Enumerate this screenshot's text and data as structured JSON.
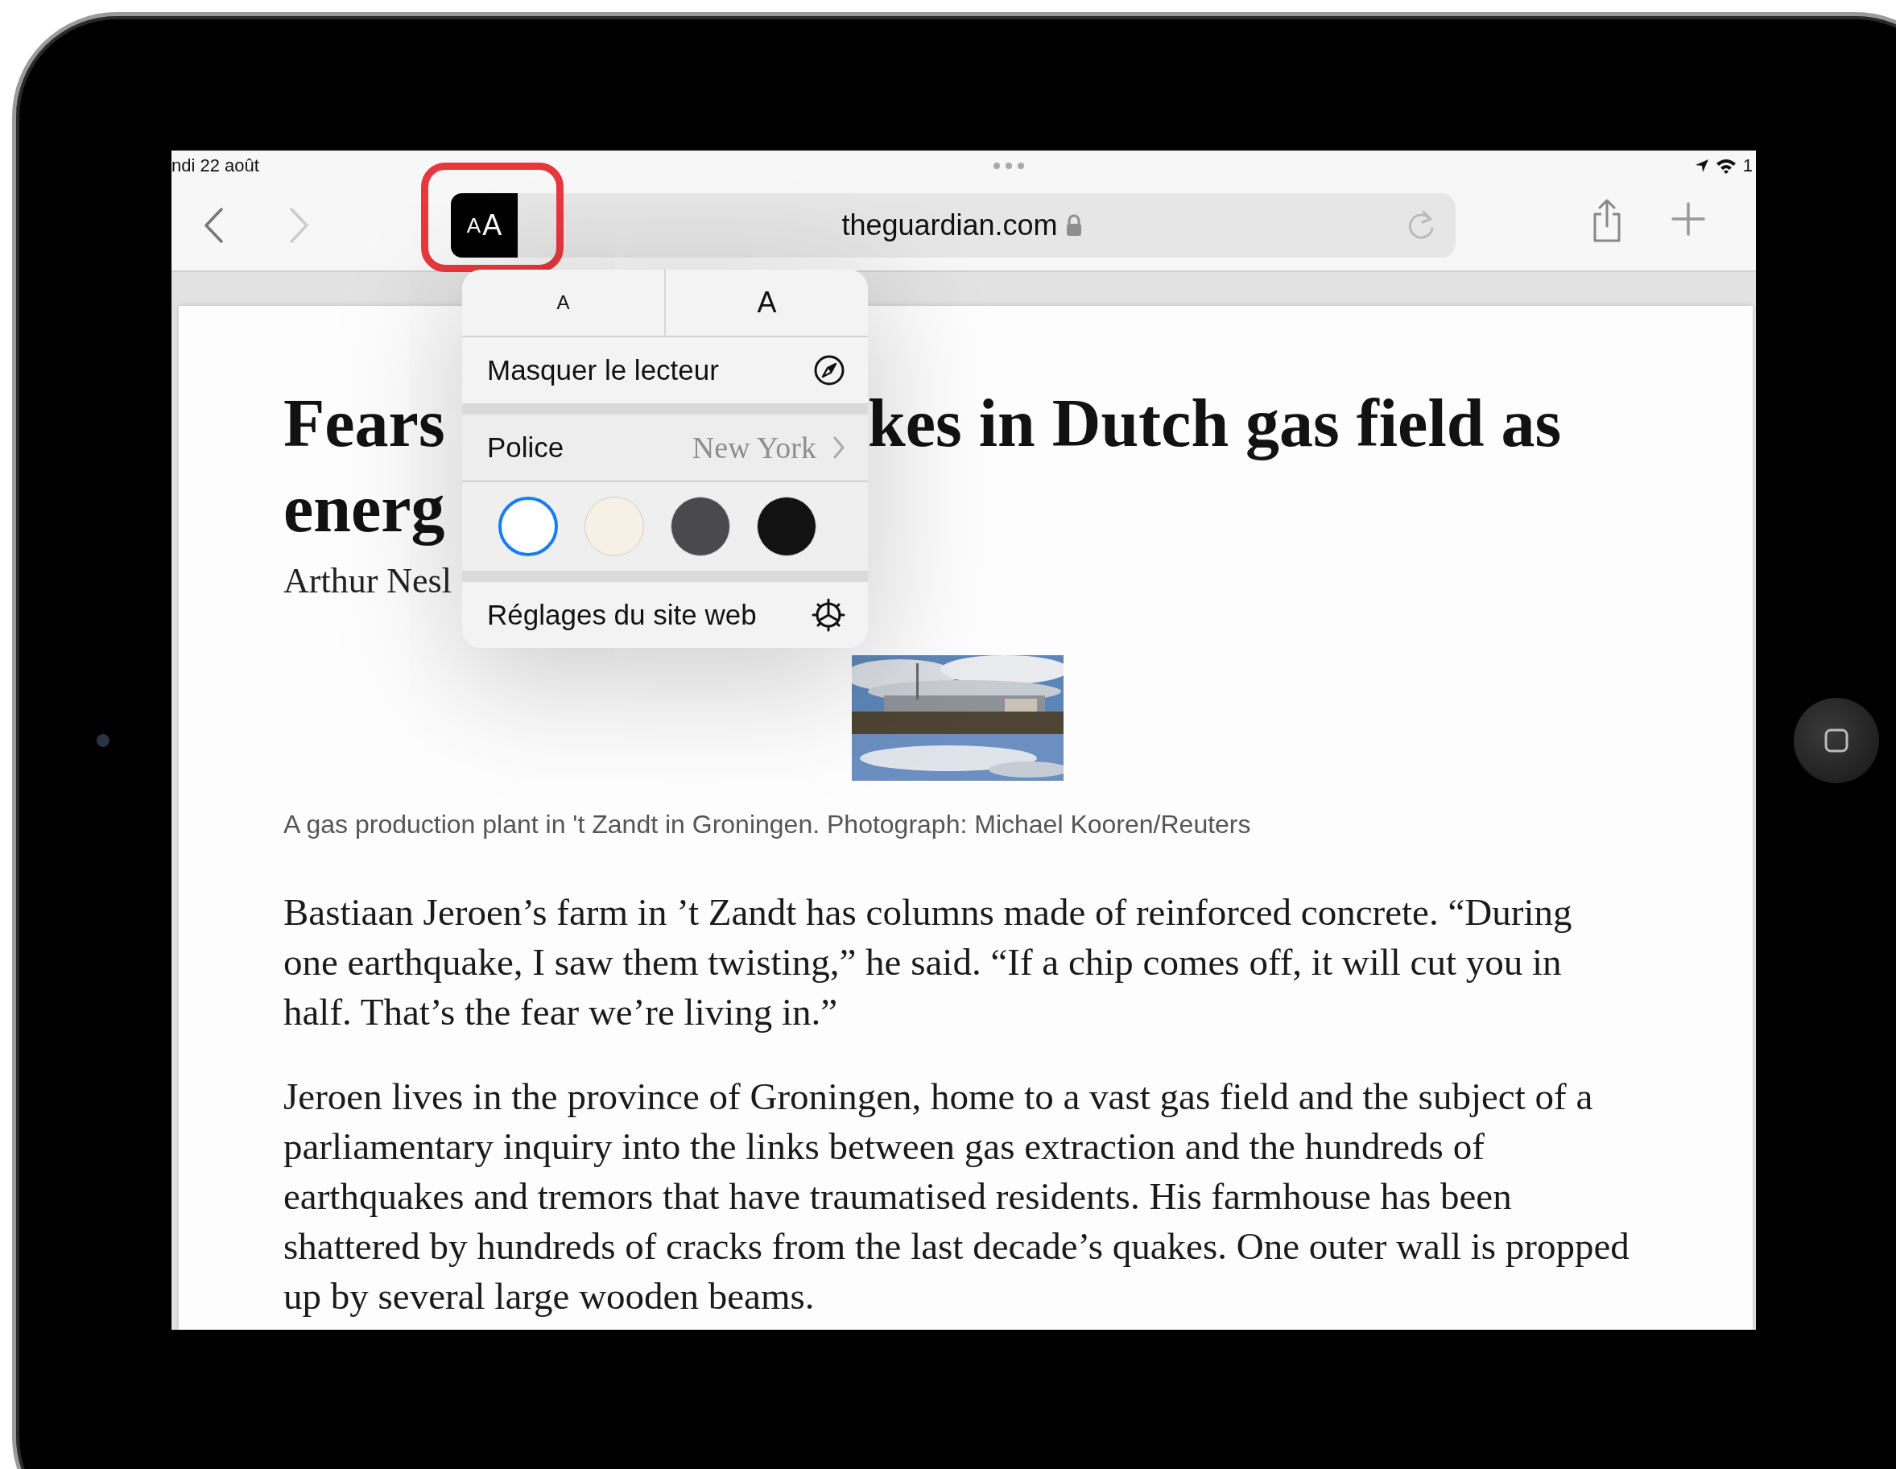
{
  "status_bar": {
    "date": "ndi 22 août",
    "battery_fragment": "1"
  },
  "toolbar": {
    "reader_button": {
      "small": "A",
      "large": "A",
      "highlighted": true
    },
    "url": "theguardian.com"
  },
  "reader_menu": {
    "text_size": [
      {
        "label": "A",
        "kind": "smaller"
      },
      {
        "label": "A",
        "kind": "larger"
      }
    ],
    "hide_reader": "Masquer le lecteur",
    "font": {
      "label": "Police",
      "value": "New York"
    },
    "themes": [
      {
        "color": "#ffffff",
        "selected": true
      },
      {
        "color": "#f7f0e4",
        "selected": false
      },
      {
        "color": "#4a4a4c",
        "selected": false
      },
      {
        "color": "#121212",
        "selected": false
      }
    ],
    "website_settings": "Réglages du site web"
  },
  "article": {
    "headline": {
      "line_1_left": "Fears",
      "line_1_right": "kes in Dutch gas field as",
      "line_2": "energ"
    },
    "byline": "Arthur Nesl",
    "caption": "A gas production plant in 't Zandt in Groningen. Photograph: Michael Kooren/Reuters",
    "paragraphs": [
      "Bastiaan Jeroen’s farm in ’t Zandt has columns made of reinforced concrete. “During one earthquake, I saw them twisting,” he said. “If a chip comes off, it will cut you in half. That’s the fear we’re living in.”",
      "Jeroen lives in the province of Groningen, home to a vast gas field and the subject of a parliamentary inquiry into the links between gas extraction and the hundreds of earthquakes and tremors that have traumatised residents. His farmhouse has been shattered by hundreds of cracks from the last decade’s quakes. One outer wall is propped up by several large wooden beams."
    ]
  }
}
